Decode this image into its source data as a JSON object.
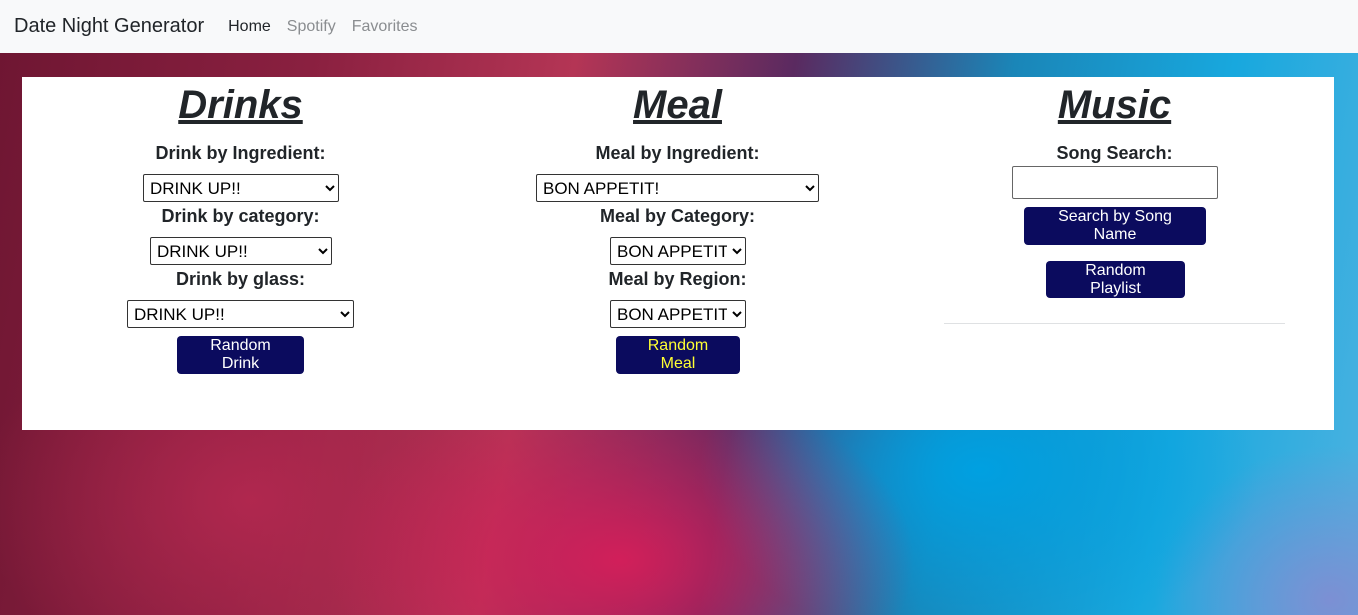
{
  "nav": {
    "brand": "Date Night Generator",
    "links": [
      "Home",
      "Spotify",
      "Favorites"
    ]
  },
  "drinks": {
    "title": "Drinks",
    "ingredient_label": "Drink by Ingredient:",
    "ingredient_value": "DRINK UP!!",
    "category_label": "Drink by category:",
    "category_value": "DRINK UP!!",
    "glass_label": "Drink by glass:",
    "glass_value": "DRINK UP!!",
    "random_button": "Random Drink"
  },
  "meal": {
    "title": "Meal",
    "ingredient_label": "Meal by Ingredient:",
    "ingredient_value": "BON APPETIT!",
    "category_label": "Meal by Category:",
    "category_value": "BON APPETIT!",
    "region_label": "Meal by Region:",
    "region_value": "BON APPETIT!",
    "random_button": "Random Meal"
  },
  "music": {
    "title": "Music",
    "search_label": "Song Search:",
    "search_value": "",
    "search_button": "Search by Song Name",
    "playlist_button": "Random Playlist"
  },
  "colors": {
    "button_bg": "#0b0b5e",
    "button_text": "#ffffff",
    "random_meal_text": "#ffff33"
  }
}
